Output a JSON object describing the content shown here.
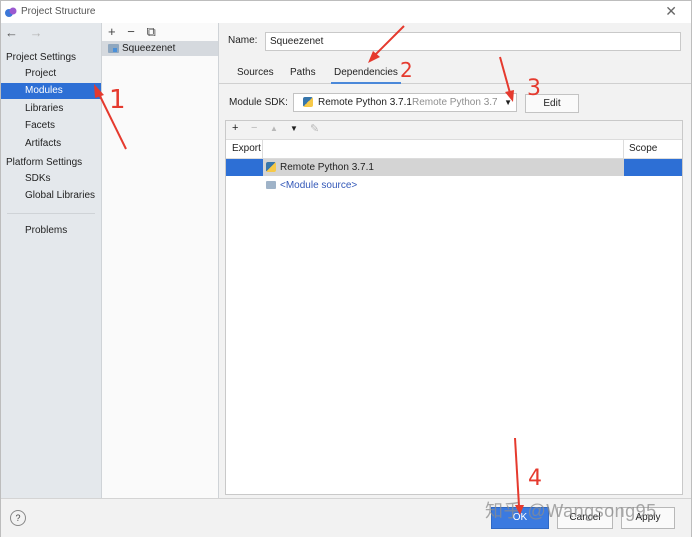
{
  "window": {
    "title": "Project Structure",
    "close_glyph": "✕"
  },
  "nav": {
    "back": "←",
    "forward": "→"
  },
  "sidebar": {
    "section1": "Project Settings",
    "items1": [
      {
        "label": "Project"
      },
      {
        "label": "Modules",
        "selected": true
      },
      {
        "label": "Libraries"
      },
      {
        "label": "Facets"
      },
      {
        "label": "Artifacts"
      }
    ],
    "section2": "Platform Settings",
    "items2": [
      {
        "label": "SDKs"
      },
      {
        "label": "Global Libraries"
      }
    ],
    "problems": "Problems"
  },
  "modules": {
    "tools": [
      "+",
      "−",
      "⧉"
    ],
    "items": [
      {
        "label": "Squeezenet"
      }
    ]
  },
  "detail": {
    "name_label": "Name:",
    "name_value": "Squeezenet",
    "tabs": [
      {
        "label": "Sources"
      },
      {
        "label": "Paths"
      },
      {
        "label": "Dependencies",
        "active": true
      }
    ],
    "sdk_label": "Module SDK:",
    "sdk_value": "Remote Python 3.7.1",
    "sdk_value_detail": "Remote Python 3.7.1",
    "edit_label": "Edit"
  },
  "dependencies": {
    "toolbar": [
      "+",
      "−",
      "▲",
      "▼",
      "✎"
    ],
    "columns": {
      "export": "Export",
      "scope": "Scope"
    },
    "rows": [
      {
        "label": "Remote Python 3.7.1",
        "selected": true
      },
      {
        "label": "<Module source>",
        "selected": false
      }
    ]
  },
  "footer": {
    "help": "?",
    "ok": "OK",
    "cancel": "Cancel",
    "apply": "Apply"
  },
  "annotations": {
    "n1": "1",
    "n2": "2",
    "n3": "3",
    "n4": "4",
    "color": "#e53a2e"
  },
  "watermark": "知乎 @Wangsong95",
  "colors": {
    "selection": "#2d6fd5",
    "ok_button": "#3b7ae0",
    "link": "#3358b8"
  }
}
